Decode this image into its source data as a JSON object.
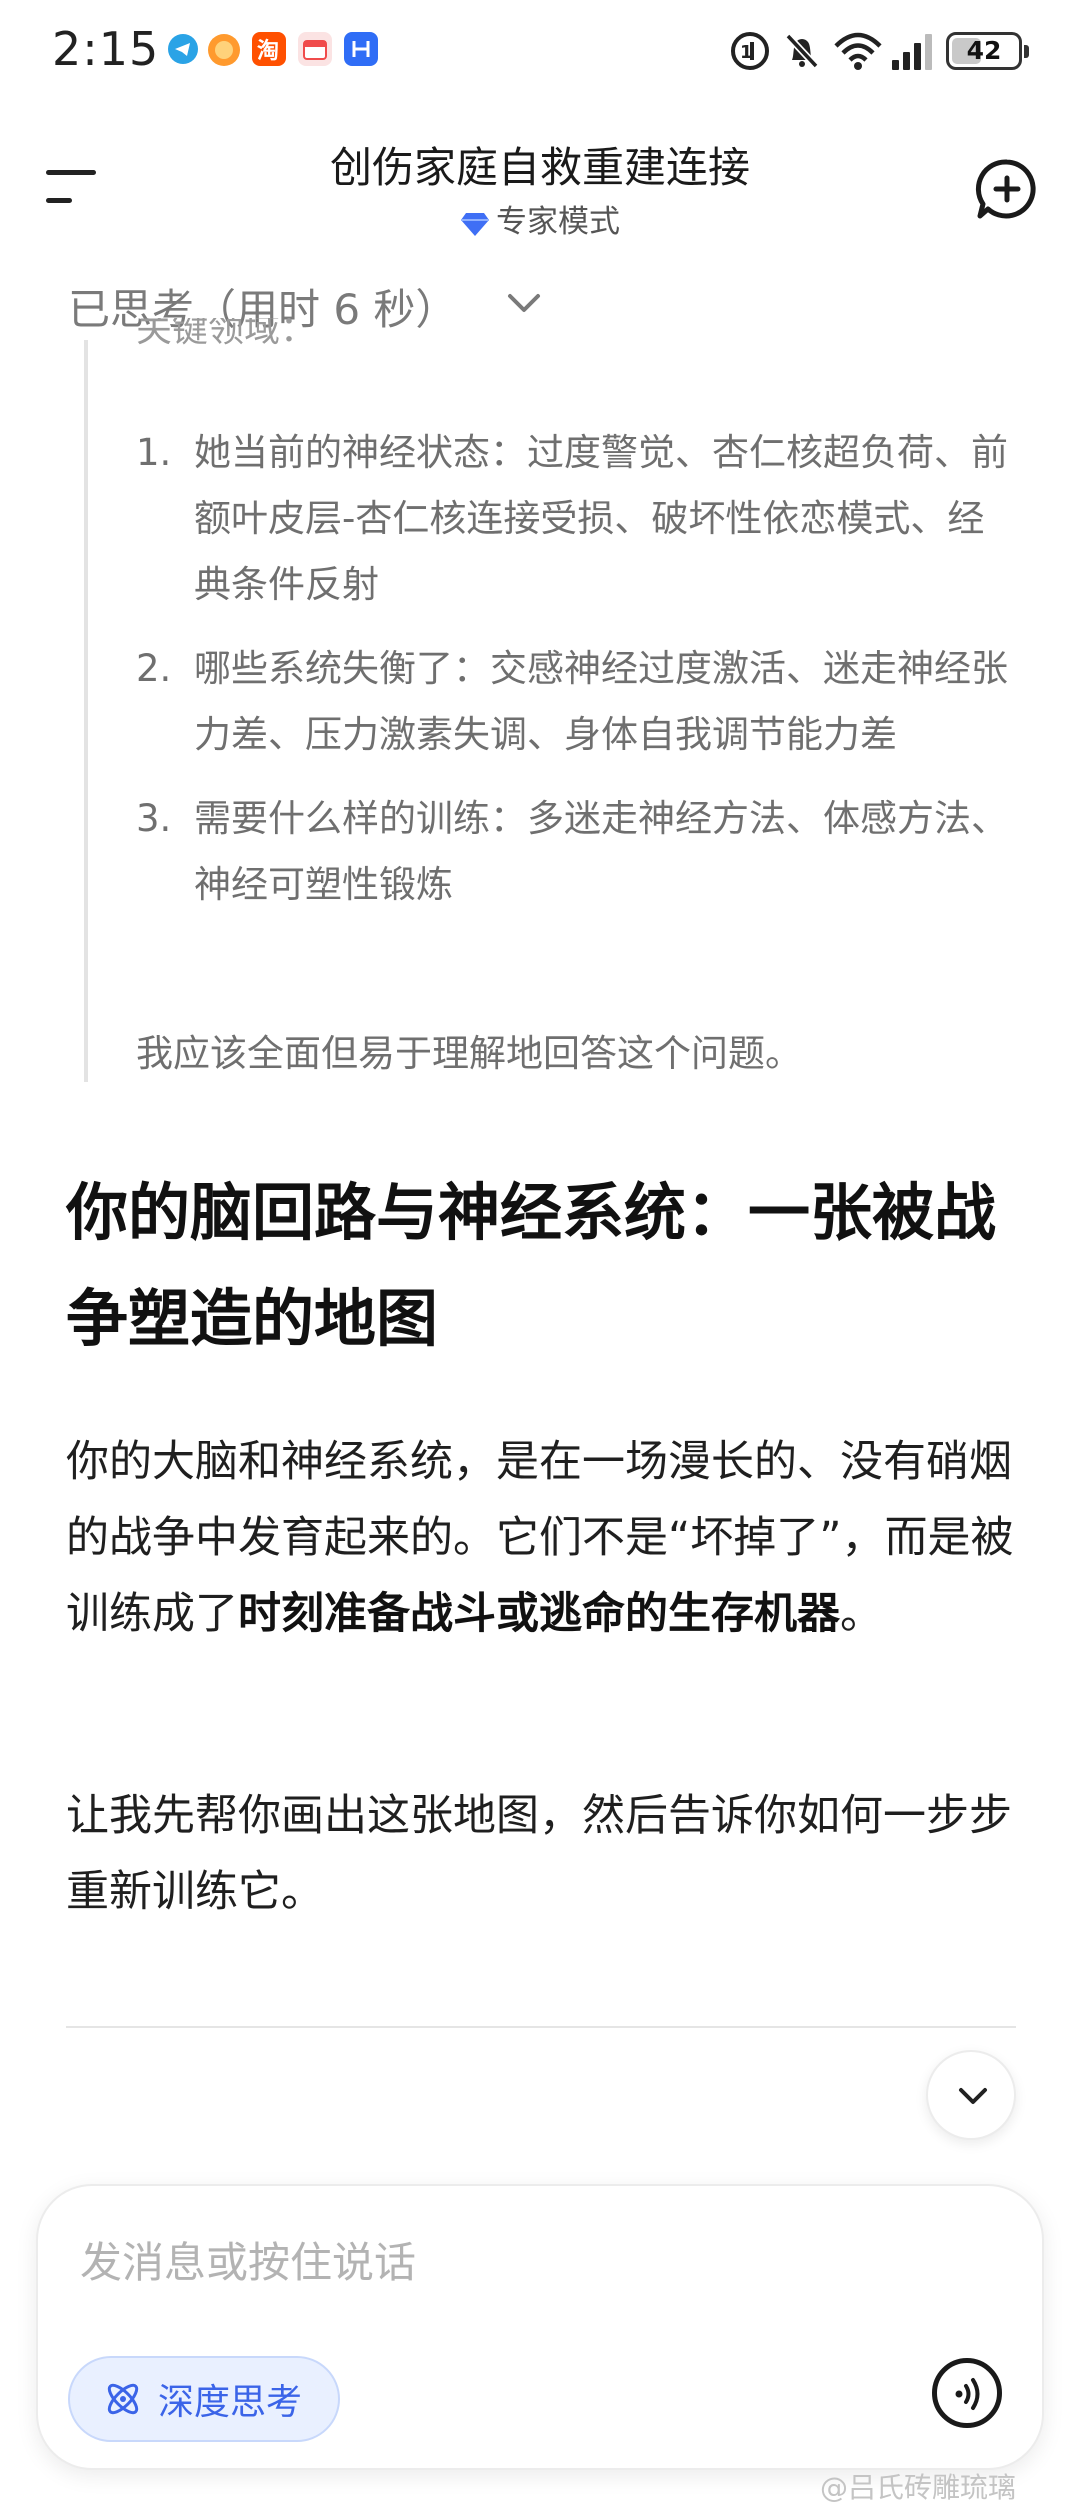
{
  "status_bar": {
    "time": "2:15",
    "notifications": [
      {
        "icon": "telegram-app-icon",
        "color": "#2aa3e6"
      },
      {
        "icon": "orange-app-icon",
        "color": "#ff8a1f"
      },
      {
        "icon": "taobao-app-icon",
        "color": "#ff5000"
      },
      {
        "icon": "calendar-app-icon",
        "color": "#f04b4b"
      },
      {
        "icon": "blue-app-icon",
        "color": "#2f6df6"
      }
    ],
    "battery": "42"
  },
  "header": {
    "title": "创伤家庭自救重建连接",
    "mode": "专家模式"
  },
  "thinking": {
    "label": "已思考（用时 6 秒）",
    "cut_line": "关键领域：",
    "items": [
      {
        "num": "1.",
        "text": "她当前的神经状态：过度警觉、杏仁核超负荷、前额叶皮层-杏仁核连接受损、破坏性依恋模式、经典条件反射"
      },
      {
        "num": "2.",
        "text": "哪些系统失衡了：交感神经过度激活、迷走神经张力差、压力激素失调、身体自我调节能力差"
      },
      {
        "num": "3.",
        "text": "需要什么样的训练：多迷走神经方法、体感方法、神经可塑性锻炼"
      }
    ],
    "conclusion": "我应该全面但易于理解地回答这个问题。"
  },
  "answer": {
    "heading": "你的脑回路与神经系统：一张被战争塑造的地图",
    "p1_text": "你的大脑和神经系统，是在一场漫长的、没有硝烟的战争中发育起来的。它们不是“坏掉了”，而是被训练成了",
    "p1_bold": "时刻准备战斗或逃命的生存机器",
    "p1_end": "。",
    "p2": "让我先帮你画出这张地图，然后告诉你如何一步步重新训练它。"
  },
  "composer": {
    "placeholder": "发消息或按住说话",
    "deep_think_label": "深度思考"
  },
  "watermark": "@吕氏砖雕琉璃",
  "colors": {
    "accent": "#3b64e8",
    "mode_diamond": "#3f6ff5"
  }
}
